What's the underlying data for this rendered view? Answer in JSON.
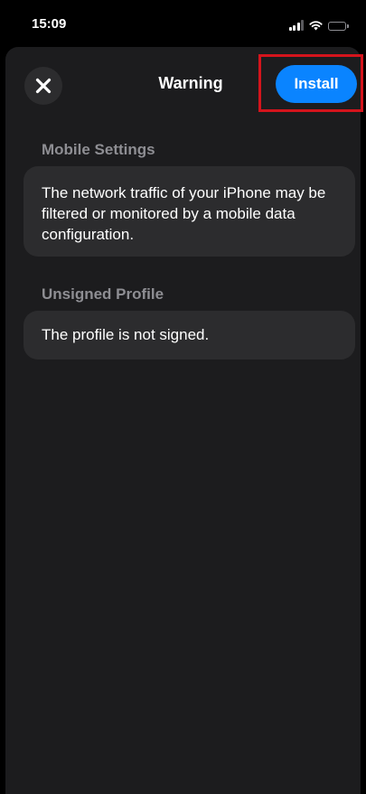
{
  "status_bar": {
    "time": "15:09",
    "icons": [
      "cellular-signal-icon",
      "wifi-icon",
      "battery-icon"
    ]
  },
  "nav": {
    "title": "Warning",
    "close_icon": "close-icon",
    "install_label": "Install"
  },
  "sections": [
    {
      "header": "Mobile Settings",
      "body": "The network traffic of your iPhone may be filtered or monitored by a mobile data configuration."
    },
    {
      "header": "Unsigned Profile",
      "body": "The profile is not signed."
    }
  ],
  "colors": {
    "background": "#000000",
    "sheet": "#1c1c1e",
    "card": "#2c2c2e",
    "accent": "#0a84ff",
    "section_header": "#8e8e93",
    "highlight": "#d4141c"
  }
}
